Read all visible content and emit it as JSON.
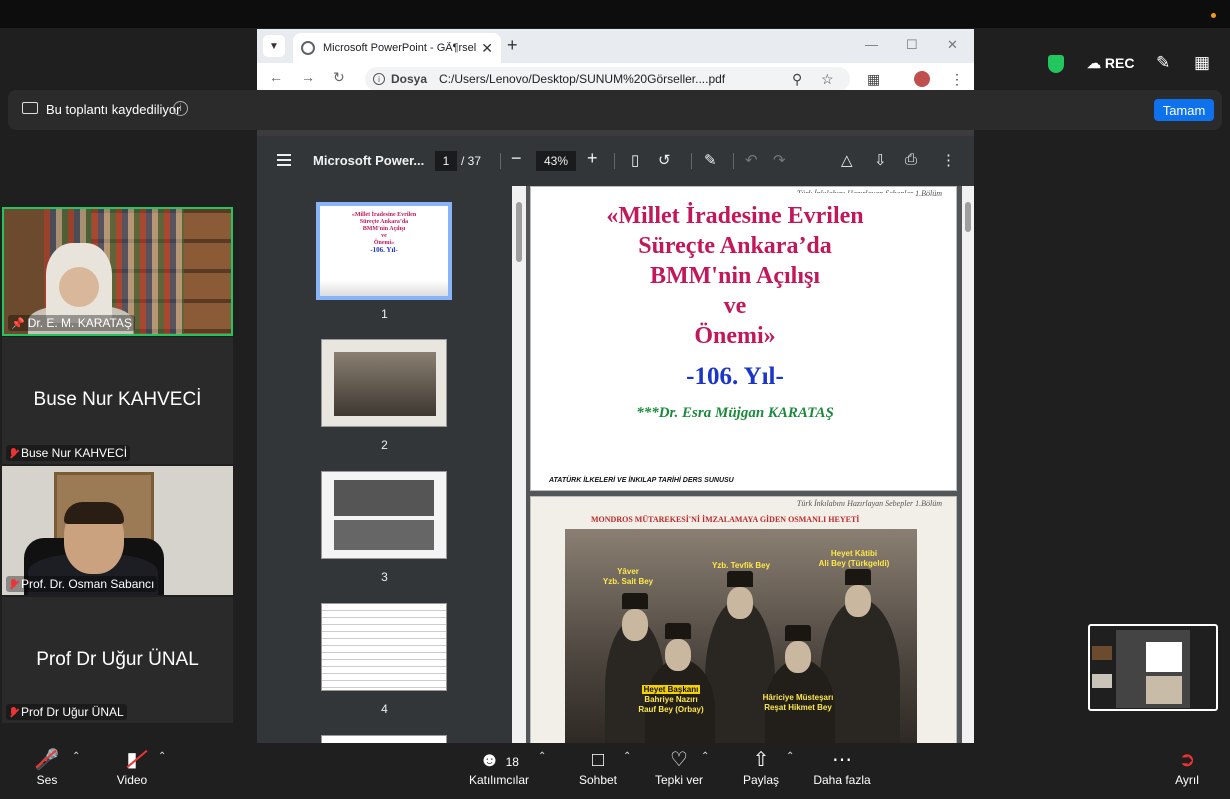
{
  "browser": {
    "tab_title": "Microsoft PowerPoint - GÃ¶rsel",
    "url_label": "Dosya",
    "url": "C:/Users/Lenovo/Desktop/SUNUM%20Görseller....pdf"
  },
  "banner": {
    "text": "Bu toplantı kaydediliyor",
    "ok_label": "Tamam"
  },
  "pdf": {
    "title": "Microsoft Power...",
    "page": "1",
    "page_total": "/ 37",
    "zoom": "43%",
    "thumbs": [
      "1",
      "2",
      "3",
      "4"
    ],
    "slide1": {
      "header": "Türk İnkılabını Hazırlayan Sebepler 1.Bölüm",
      "title_lines": [
        "«Millet İradesine Evrilen",
        "Süreçte Ankara’da",
        "BMM'nin Açılışı",
        "ve",
        "Önemi»"
      ],
      "year": "-106. Yıl-",
      "author": "***Dr. Esra Müjgan KARATAŞ",
      "footer": "ATATÜRK İLKELERİ VE İNKILAP TARİHİ DERS SUNUSU",
      "thumb_year": "-106. Yıl-"
    },
    "slide2": {
      "header": "Türk İnkılabını Hazırlayan Sebepler 1.Bölüm",
      "title": "MONDROS MÜTAREKESİ'Nİ İMZALAMAYA GİDEN OSMANLI HEYETİ",
      "labels": {
        "yaver": "Yâver",
        "yaver2": "Yzb. Sait Bey",
        "tevfik": "Yzb. Tevfik Bey",
        "katib": "Heyet Kâtibi",
        "katib2": "Ali Bey (Türkgeldi)",
        "baskan": "Heyet Başkanı",
        "baskan2": "Bahriye Nazırı",
        "baskan3": "Rauf Bey (Orbay)",
        "hariciye": "Hâriciye Müsteşarı",
        "hariciye2": "Reşat Hikmet Bey"
      }
    }
  },
  "zoom_top": {
    "rec": "REC"
  },
  "participants": [
    {
      "name": "Dr. E. M. KARATAŞ"
    },
    {
      "name": "Buse Nur KAHVECİ",
      "big": "Buse Nur KAHVECİ"
    },
    {
      "name": "Prof. Dr. Osman Sabancı"
    },
    {
      "name": "Prof Dr Uğur ÜNAL",
      "big": "Prof Dr Uğur ÜNAL"
    }
  ],
  "controls": {
    "audio": "Ses",
    "video": "Video",
    "participants": "Katılımcılar",
    "participants_count": "18",
    "chat": "Sohbet",
    "react": "Tepki ver",
    "share": "Paylaş",
    "more": "Daha fazla",
    "leave": "Ayrıl"
  },
  "colors": {
    "accent": "#0e72ed",
    "active_speaker": "#22c55e",
    "muted": "#e33333"
  }
}
